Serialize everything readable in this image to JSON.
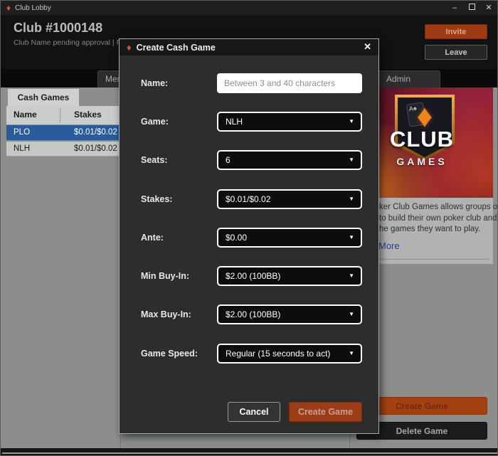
{
  "icons": {
    "caret": "▼",
    "close": "✕",
    "minimize": "–",
    "diamond": "♦",
    "spade": "♠",
    "card_rank": "A"
  },
  "colors": {
    "accent_orange": "#9e3b12",
    "selected_row_blue": "#2a5b9d",
    "link_blue": "#1c4096",
    "modal_bg": "#2d2d2d",
    "content_gray": "#8b8e8b"
  },
  "titlebar": {
    "title": "Club Lobby"
  },
  "header": {
    "club_title": "Club #1000148",
    "club_subtitle": "Club Name pending approval | Fou",
    "invite_label": "Invite",
    "leave_label": "Leave"
  },
  "tabs": {
    "members_label": "Members",
    "admin_label": "Admin"
  },
  "left_panel": {
    "tab_label": "Cash Games",
    "columns": {
      "name": "Name",
      "stakes": "Stakes"
    },
    "rows": [
      {
        "name": "PLO",
        "stakes": "$0.01/$0.02",
        "selected": true
      },
      {
        "name": "NLH",
        "stakes": "$0.01/$0.02",
        "selected": false
      }
    ]
  },
  "right_panel": {
    "logo": {
      "line1": "CLUB",
      "line2": "GAMES"
    },
    "description_lines": [
      "ker Club Games allows groups of",
      "to build their own poker club and",
      "he games they want to play."
    ],
    "more_label": "More",
    "create_game_label": "Create Game",
    "delete_game_label": "Delete Game"
  },
  "modal": {
    "title": "Create Cash Game",
    "fields": [
      {
        "label": "Name:",
        "type": "input",
        "placeholder": "Between 3 and 40 characters"
      },
      {
        "label": "Game:",
        "type": "select",
        "value": "NLH"
      },
      {
        "label": "Seats:",
        "type": "select",
        "value": "6"
      },
      {
        "label": "Stakes:",
        "type": "select",
        "value": "$0.01/$0.02"
      },
      {
        "label": "Ante:",
        "type": "select",
        "value": "$0.00"
      },
      {
        "label": "Min Buy-In:",
        "type": "select",
        "value": "$2.00 (100BB)"
      },
      {
        "label": "Max Buy-In:",
        "type": "select",
        "value": "$2.00 (100BB)"
      },
      {
        "label": "Game Speed:",
        "type": "select",
        "value": "Regular (15 seconds to act)"
      }
    ],
    "cancel_label": "Cancel",
    "create_label": "Create Game"
  }
}
